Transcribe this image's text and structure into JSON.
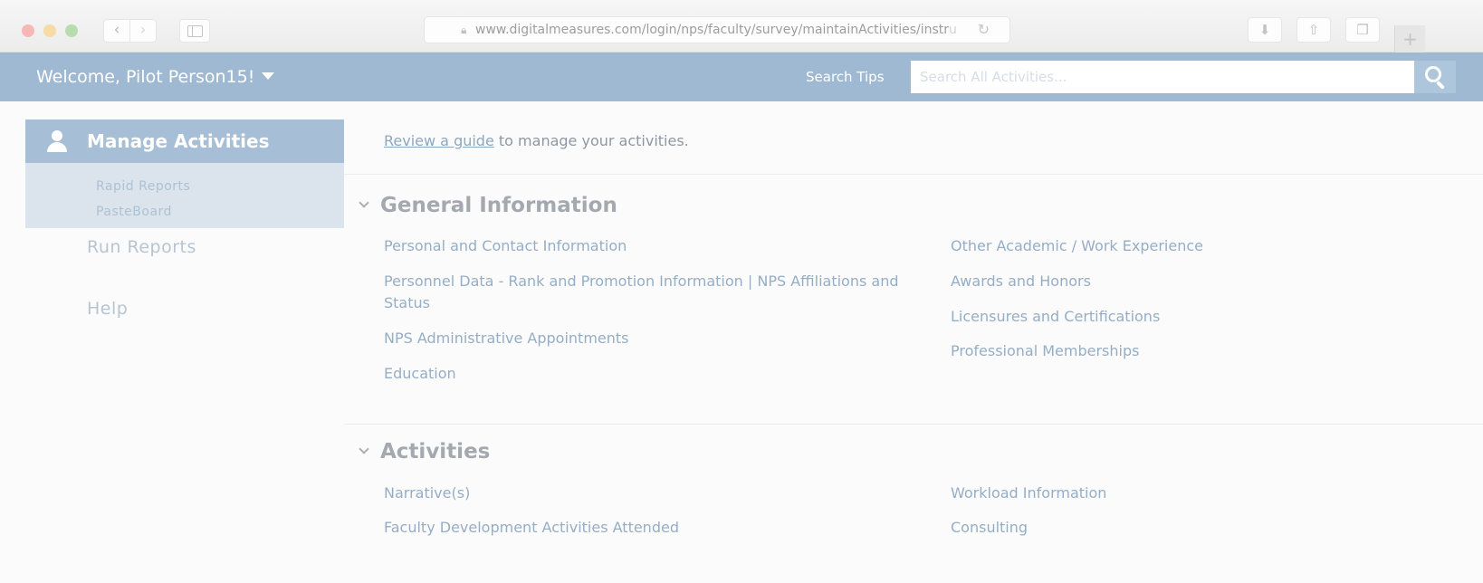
{
  "browser": {
    "url_visible": "www.digitalmeasures.com/login/nps/faculty/survey/maintainActivities/instr",
    "url_fade": "u",
    "icons": [
      "back-icon",
      "forward-icon",
      "sidebar-icon",
      "lock-icon",
      "reload-icon",
      "download-icon",
      "share-icon",
      "tabs-icon",
      "plus-icon"
    ]
  },
  "header": {
    "welcome": "Welcome, Pilot Person15!",
    "search_tips": "Search Tips",
    "search_placeholder": "Search All Activities...",
    "colors": {
      "header_bg": "#9fb9d3",
      "nav_active_bg": "#a7bfd6"
    }
  },
  "nav": {
    "active": {
      "label": "Manage Activities",
      "subitems": [
        "Rapid Reports",
        "PasteBoard"
      ]
    },
    "items": [
      "Run Reports",
      "Help"
    ]
  },
  "main": {
    "guide_link": "Review a guide",
    "guide_rest": " to manage your activities.",
    "sections": [
      {
        "title": "General Information",
        "col1": [
          "Personal and Contact Information",
          "Personnel Data - Rank and Promotion Information | NPS Affiliations and Status",
          "NPS Administrative Appointments",
          "Education"
        ],
        "col2": [
          "Other Academic / Work Experience",
          "Awards and Honors",
          "Licensures and Certifications",
          "Professional Memberships"
        ]
      },
      {
        "title": "Activities",
        "col1": [
          "Narrative(s)",
          "Faculty Development Activities Attended"
        ],
        "col2": [
          "Workload Information",
          "Consulting"
        ]
      }
    ]
  }
}
